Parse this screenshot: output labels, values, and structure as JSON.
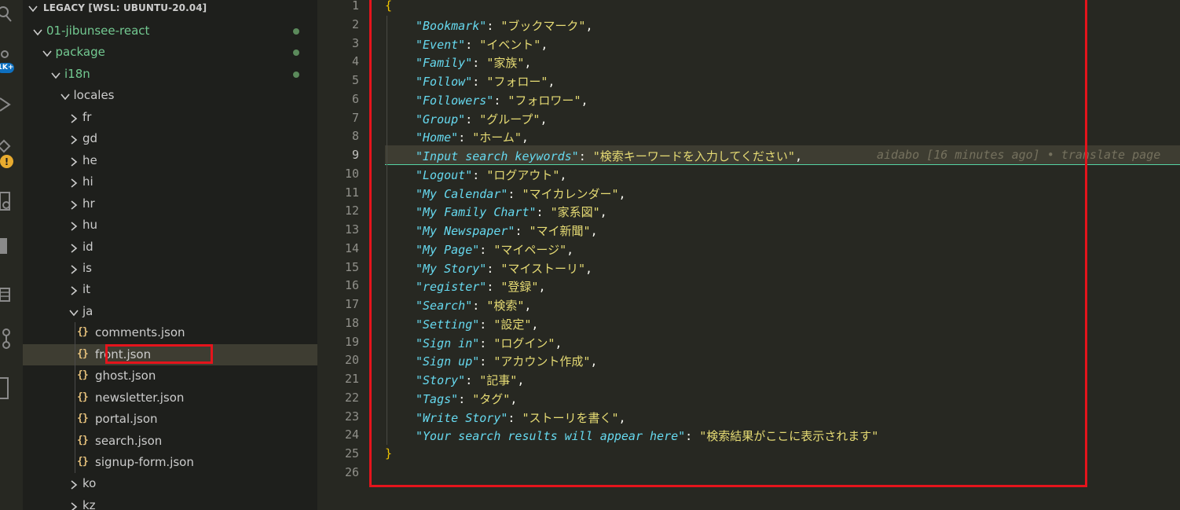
{
  "activity_bar": {
    "icons": [
      "search-icon",
      "source-control-icon",
      "run-debug-icon",
      "extensions-icon",
      "remote-explorer-icon",
      "docker-icon",
      "database-icon",
      "git-graph-icon",
      "notebook-icon"
    ],
    "scm_badge": "1K+"
  },
  "sidebar": {
    "title": "LEGACY [WSL: UBUNTU-20.04]",
    "tree": [
      {
        "label": "01-jibunsee-react",
        "type": "folder",
        "expanded": true,
        "depth": 1,
        "modified": true
      },
      {
        "label": "package",
        "type": "folder",
        "expanded": true,
        "depth": 2,
        "modified": true
      },
      {
        "label": "i18n",
        "type": "folder",
        "expanded": true,
        "depth": 3,
        "modified": true
      },
      {
        "label": "locales",
        "type": "folder",
        "expanded": true,
        "depth": 4,
        "modified": false
      },
      {
        "label": "fr",
        "type": "folder",
        "expanded": false,
        "depth": 5
      },
      {
        "label": "gd",
        "type": "folder",
        "expanded": false,
        "depth": 5
      },
      {
        "label": "he",
        "type": "folder",
        "expanded": false,
        "depth": 5
      },
      {
        "label": "hi",
        "type": "folder",
        "expanded": false,
        "depth": 5
      },
      {
        "label": "hr",
        "type": "folder",
        "expanded": false,
        "depth": 5
      },
      {
        "label": "hu",
        "type": "folder",
        "expanded": false,
        "depth": 5
      },
      {
        "label": "id",
        "type": "folder",
        "expanded": false,
        "depth": 5
      },
      {
        "label": "is",
        "type": "folder",
        "expanded": false,
        "depth": 5
      },
      {
        "label": "it",
        "type": "folder",
        "expanded": false,
        "depth": 5
      },
      {
        "label": "ja",
        "type": "folder",
        "expanded": true,
        "depth": 5
      },
      {
        "label": "comments.json",
        "type": "file",
        "depth": 6
      },
      {
        "label": "front.json",
        "type": "file",
        "depth": 6,
        "selected": true
      },
      {
        "label": "ghost.json",
        "type": "file",
        "depth": 6
      },
      {
        "label": "newsletter.json",
        "type": "file",
        "depth": 6
      },
      {
        "label": "portal.json",
        "type": "file",
        "depth": 6
      },
      {
        "label": "search.json",
        "type": "file",
        "depth": 6
      },
      {
        "label": "signup-form.json",
        "type": "file",
        "depth": 6
      },
      {
        "label": "ko",
        "type": "folder",
        "expanded": false,
        "depth": 5
      },
      {
        "label": "kz",
        "type": "folder",
        "expanded": false,
        "depth": 5
      }
    ],
    "json_icon_text": "{}"
  },
  "editor": {
    "open_brace": "{",
    "close_brace": "}",
    "active_line": 9,
    "blame": "aidabo [16 minutes ago] • translate page",
    "entries": [
      {
        "key": "\"Bookmark\"",
        "value": "\"ブックマーク\""
      },
      {
        "key": "\"Event\"",
        "value": "\"イベント\""
      },
      {
        "key": "\"Family\"",
        "value": "\"家族\""
      },
      {
        "key": "\"Follow\"",
        "value": "\"フォロー\""
      },
      {
        "key": "\"Followers\"",
        "value": "\"フォロワー\""
      },
      {
        "key": "\"Group\"",
        "value": "\"グループ\""
      },
      {
        "key": "\"Home\"",
        "value": "\"ホーム\""
      },
      {
        "key": "\"Input search keywords\"",
        "value": "\"検索キーワードを入力してください\""
      },
      {
        "key": "\"Logout\"",
        "value": "\"ログアウト\""
      },
      {
        "key": "\"My Calendar\"",
        "value": "\"マイカレンダー\""
      },
      {
        "key": "\"My Family Chart\"",
        "value": "\"家系図\""
      },
      {
        "key": "\"My Newspaper\"",
        "value": "\"マイ新聞\""
      },
      {
        "key": "\"My Page\"",
        "value": "\"マイページ\""
      },
      {
        "key": "\"My Story\"",
        "value": "\"マイストーリ\""
      },
      {
        "key": "\"register\"",
        "value": "\"登録\""
      },
      {
        "key": "\"Search\"",
        "value": "\"検索\""
      },
      {
        "key": "\"Setting\"",
        "value": "\"設定\""
      },
      {
        "key": "\"Sign in\"",
        "value": "\"ログイン\""
      },
      {
        "key": "\"Sign up\"",
        "value": "\"アカウント作成\""
      },
      {
        "key": "\"Story\"",
        "value": "\"記事\""
      },
      {
        "key": "\"Tags\"",
        "value": "\"タグ\""
      },
      {
        "key": "\"Write Story\"",
        "value": "\"ストーリを書く\""
      },
      {
        "key": "\"Your search results will appear here\"",
        "value": "\"検索結果がここに表示されます\""
      }
    ],
    "line_numbers": [
      "1",
      "2",
      "3",
      "4",
      "5",
      "6",
      "7",
      "8",
      "9",
      "10",
      "11",
      "12",
      "13",
      "14",
      "15",
      "16",
      "17",
      "18",
      "19",
      "20",
      "21",
      "22",
      "23",
      "24",
      "25",
      "26"
    ]
  },
  "colors": {
    "annotation_red": "#e4141c",
    "key": "#66d9ef",
    "string": "#e6db74",
    "modified_green": "#73c991"
  }
}
